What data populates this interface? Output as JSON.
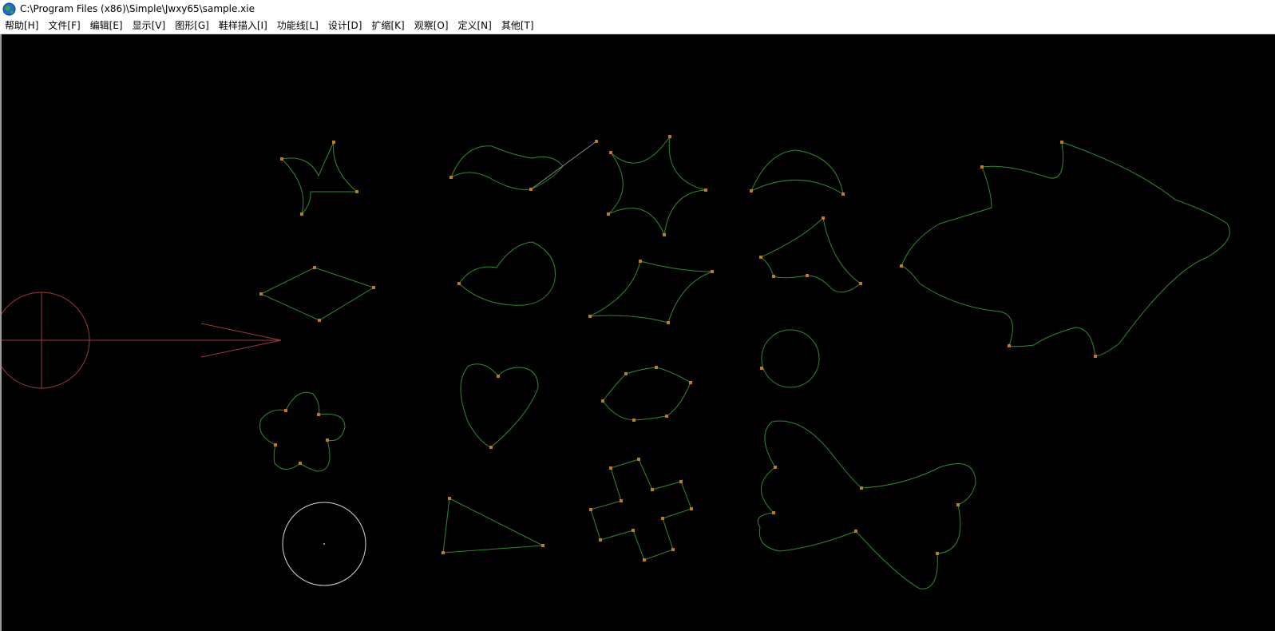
{
  "window": {
    "title": "C:\\Program Files (x86)\\Simple\\Jwxy65\\sample.xie",
    "icon": "globe-app-icon"
  },
  "menu": [
    {
      "id": "help",
      "label": "帮助[H]"
    },
    {
      "id": "file",
      "label": "文件[F]"
    },
    {
      "id": "edit",
      "label": "编辑[E]"
    },
    {
      "id": "display",
      "label": "显示[V]"
    },
    {
      "id": "shape",
      "label": "图形[G]"
    },
    {
      "id": "shoe-trace",
      "label": "鞋样描入[I]"
    },
    {
      "id": "function-line",
      "label": "功能线[L]"
    },
    {
      "id": "design",
      "label": "设计[D]"
    },
    {
      "id": "scale",
      "label": "扩缩[K]"
    },
    {
      "id": "observe",
      "label": "观察[O]"
    },
    {
      "id": "define",
      "label": "定义[N]"
    },
    {
      "id": "other",
      "label": "其他[T]"
    }
  ],
  "canvas": {
    "background": "#000000",
    "curve_color": "#2f8a2f",
    "node_color": "#c07a1c",
    "reference_color": "#9a3b3b",
    "circle_color": "#d8d8d8",
    "handle_color": "#8a8a8a"
  }
}
